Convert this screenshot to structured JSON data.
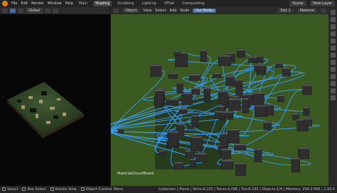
{
  "menu": [
    "File",
    "Edit",
    "Render",
    "Window",
    "Help"
  ],
  "workspaces": [
    {
      "label": "Main",
      "active": false
    },
    {
      "label": "Shading",
      "active": true
    },
    {
      "label": "Sculpting",
      "active": false
    },
    {
      "label": "Lighting",
      "active": false
    },
    {
      "label": "VFSet",
      "active": false
    },
    {
      "label": "Compositing",
      "active": false
    }
  ],
  "scene": "Scene",
  "view_layer": "View Layer",
  "left_view": {
    "orientation": "Global"
  },
  "node_editor": {
    "mode": "Object",
    "menu": [
      "View",
      "Select",
      "Add",
      "Node"
    ],
    "use_nodes": "Use Nodes",
    "slot": "Slot 1",
    "material": "Material",
    "material_label": "MaterialCircuitBoard"
  },
  "status": {
    "select": "Select",
    "box_select": "Box Select",
    "rotate": "Rotate View",
    "context_menu": "Object Context Menu",
    "stats": "Collection | Plane | Verts:4,225 | Faces:4,096 | Tris:8,192 | Objects:1/4 | Memory: 299.0 MiB | 2.93.0"
  },
  "colors": {
    "accent": "#e87d0d",
    "link": "#3aa0ff",
    "grid": "#3a5a22",
    "frame": "#25361c"
  }
}
